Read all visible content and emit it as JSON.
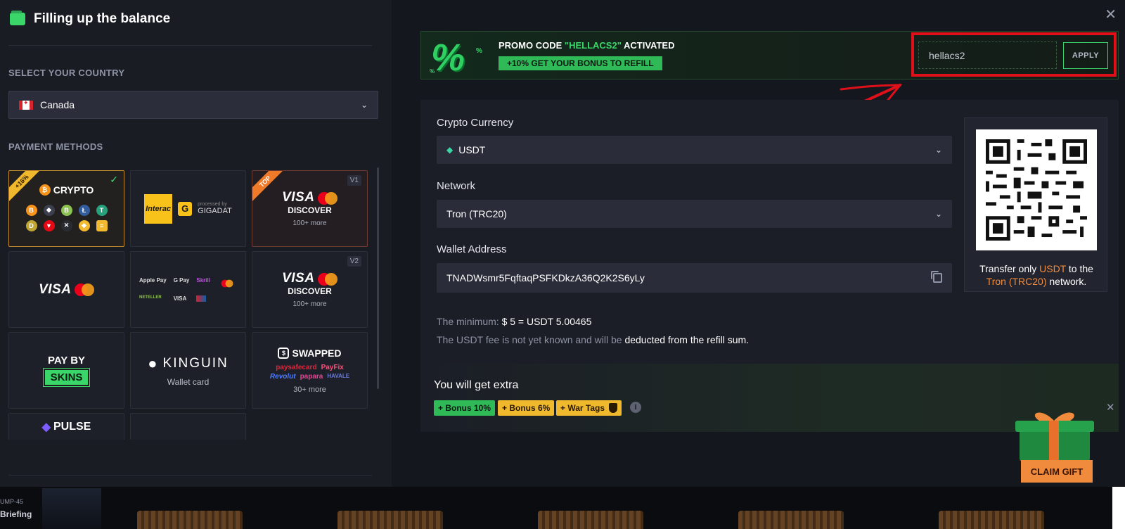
{
  "header": {
    "title": "Filling up the balance"
  },
  "country": {
    "label": "SELECT YOUR COUNTRY",
    "selected": "Canada"
  },
  "payment": {
    "label": "PAYMENT METHODS",
    "crypto": {
      "title": "CRYPTO",
      "badge": "+16%"
    },
    "interac": {
      "brand": "Interac",
      "processed_by": "processed by",
      "processor": "GIGADAT"
    },
    "card_v1": {
      "badge": "TOP",
      "version": "V1",
      "visa": "VISA",
      "discover": "DISCOVER",
      "more": "100+ more"
    },
    "visa_mc": {
      "visa": "VISA"
    },
    "wallets": {
      "items": [
        "Apple Pay",
        "G Pay",
        "Skrill",
        "MC",
        "NETELLER",
        "VISA",
        "UnionPay",
        ""
      ]
    },
    "card_v2": {
      "version": "V2",
      "visa": "VISA",
      "discover": "DISCOVER",
      "more": "100+ more"
    },
    "skins": {
      "line1": "PAY BY",
      "line2": "SKINS"
    },
    "kinguin": {
      "brand": "KINGUIN",
      "sub": "Wallet card"
    },
    "swapped": {
      "brand": "SWAPPED",
      "row1": [
        "paysafecard",
        "PayFix"
      ],
      "row2": [
        "Revolut",
        "papara",
        "HAVALE"
      ],
      "more": "30+ more"
    },
    "pulse": {
      "brand": "PULSE"
    }
  },
  "promo": {
    "prefix": "PROMO CODE",
    "code_quoted": "\"HELLACS2\"",
    "suffix": "ACTIVATED",
    "badge": "+10% GET YOUR BONUS TO REFILL",
    "input_value": "hellacs2",
    "apply_label": "APPLY"
  },
  "form": {
    "currency_label": "Crypto Currency",
    "currency_value": "USDT",
    "network_label": "Network",
    "network_value": "Tron (TRC20)",
    "wallet_label": "Wallet Address",
    "wallet_value": "TNADWsmr5FqftaqPSFKDkzA36Q2K2S6yLy",
    "minimum_prefix": "The minimum:",
    "minimum_value": "$ 5 = USDT 5.00465",
    "fee_prefix": "The USDT fee is not yet known and will be",
    "fee_bold": "deducted from the refill sum."
  },
  "qr_note": {
    "t1": "Transfer only",
    "coin": "USDT",
    "t2": "to the",
    "network": "Tron (TRC20)",
    "t3": "network."
  },
  "extra": {
    "title": "You will get extra",
    "bonuses": [
      "+ Bonus 10%",
      "+ Bonus 6%",
      "+ War Tags"
    ]
  },
  "gift": {
    "claim_label": "CLAIM GIFT"
  },
  "strip": {
    "code": "UMP-45",
    "label": "Briefing"
  },
  "colors": {
    "accent_green": "#3bd66a",
    "accent_orange": "#f28c3b",
    "highlight_red": "#e0101a"
  }
}
